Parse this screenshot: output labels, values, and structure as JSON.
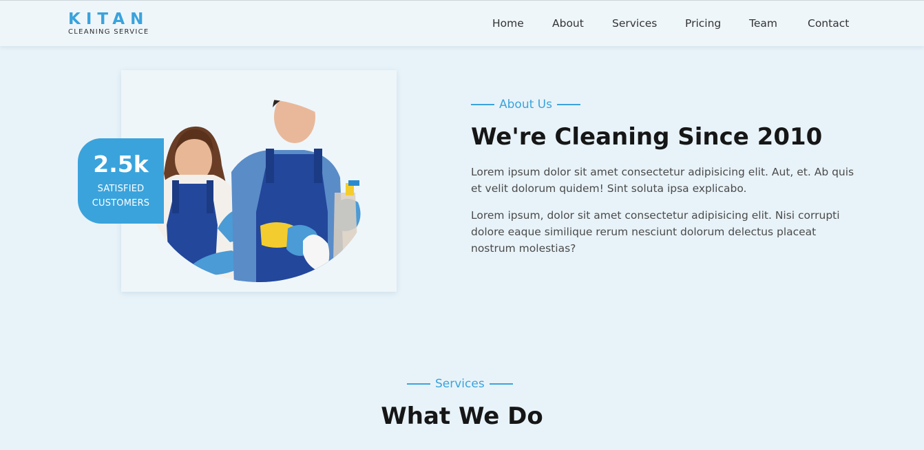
{
  "brand": {
    "name": "KITAN",
    "tagline": "CLEANING SERVICE"
  },
  "nav": {
    "items": [
      {
        "label": "Home"
      },
      {
        "label": "About"
      },
      {
        "label": "Services"
      },
      {
        "label": "Pricing"
      },
      {
        "label": "Team"
      },
      {
        "label": "Contact"
      }
    ]
  },
  "about": {
    "eyebrow": "About Us",
    "title": "We're Cleaning Since 2010",
    "paragraphs": [
      "Lorem ipsum dolor sit amet consectetur adipisicing elit. Aut, et. Ab quis et velit dolorum quidem! Sint soluta ipsa explicabo.",
      "Lorem ipsum, dolor sit amet consectetur adipisicing elit. Nisi corrupti dolore eaque similique rerum nesciunt dolorum delectus placeat nostrum molestias?"
    ],
    "stat": {
      "value": "2.5k",
      "label_line1": "SATISFIED",
      "label_line2": "CUSTOMERS"
    }
  },
  "services": {
    "eyebrow": "Services",
    "title": "What We Do"
  },
  "colors": {
    "accent": "#3aa3dc",
    "background": "#e8f3f9",
    "heading": "#161616"
  }
}
